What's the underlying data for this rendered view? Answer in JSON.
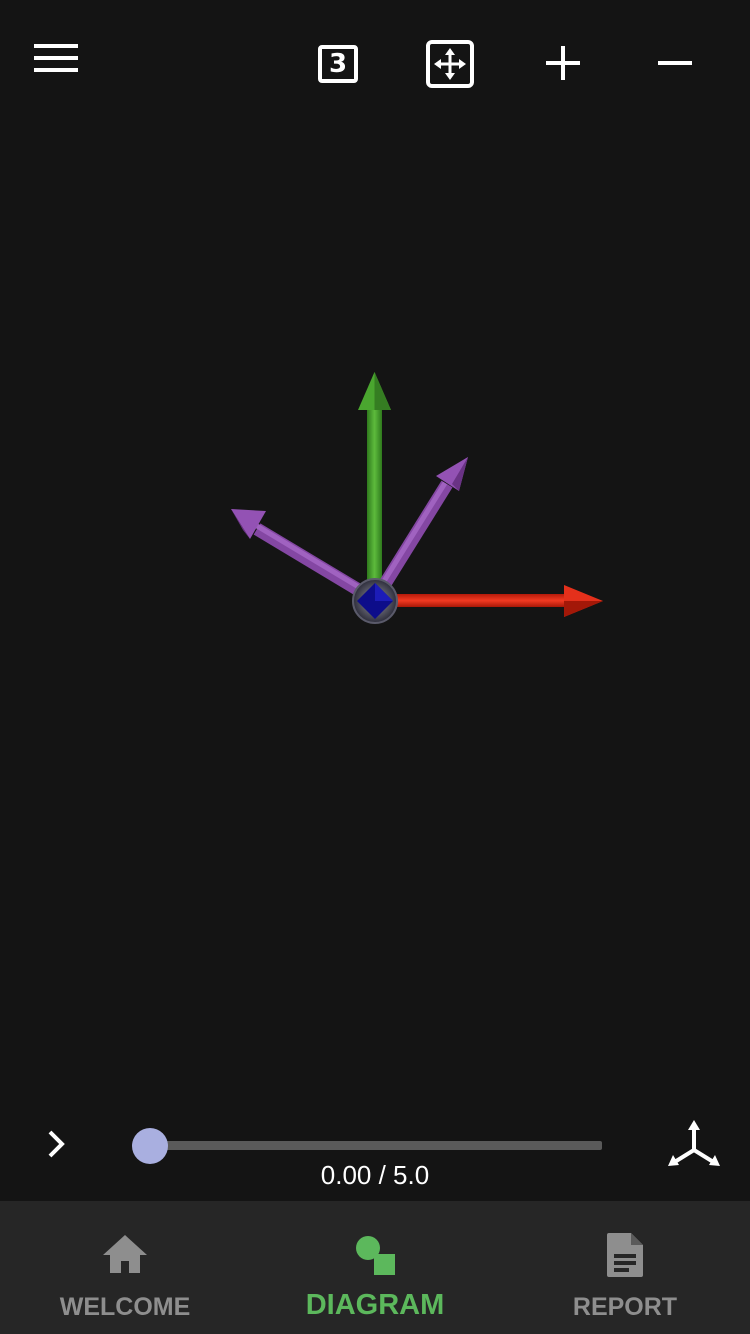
{
  "toolbar": {
    "menu_icon": "hamburger-menu-icon",
    "view_mode_label": "3",
    "fit_icon": "fit-to-screen-icon",
    "zoom_in_label": "+",
    "zoom_out_label": "−"
  },
  "diagram": {
    "vectors": [
      {
        "color": "#43a02b",
        "direction": "up"
      },
      {
        "color": "#e02a14",
        "direction": "right"
      },
      {
        "color": "#8a48a8",
        "direction": "upper-right"
      },
      {
        "color": "#8a48a8",
        "direction": "upper-left"
      }
    ],
    "origin_node_color": "#0d0d8a"
  },
  "playback": {
    "play_icon": "chevron-right-icon",
    "current_time": 0.0,
    "duration": 5.0,
    "time_text": "0.00 / 5.0",
    "axes_icon": "coordinate-axes-icon"
  },
  "nav": {
    "items": [
      {
        "label": "WELCOME",
        "icon": "home-icon",
        "active": false
      },
      {
        "label": "DIAGRAM",
        "icon": "diagram-shapes-icon",
        "active": true
      },
      {
        "label": "REPORT",
        "icon": "document-icon",
        "active": false
      }
    ]
  },
  "colors": {
    "background": "#141414",
    "nav_background": "#262626",
    "accent": "#5cb85c",
    "inactive": "#8e8e8e",
    "slider_thumb": "#a9afe0"
  }
}
